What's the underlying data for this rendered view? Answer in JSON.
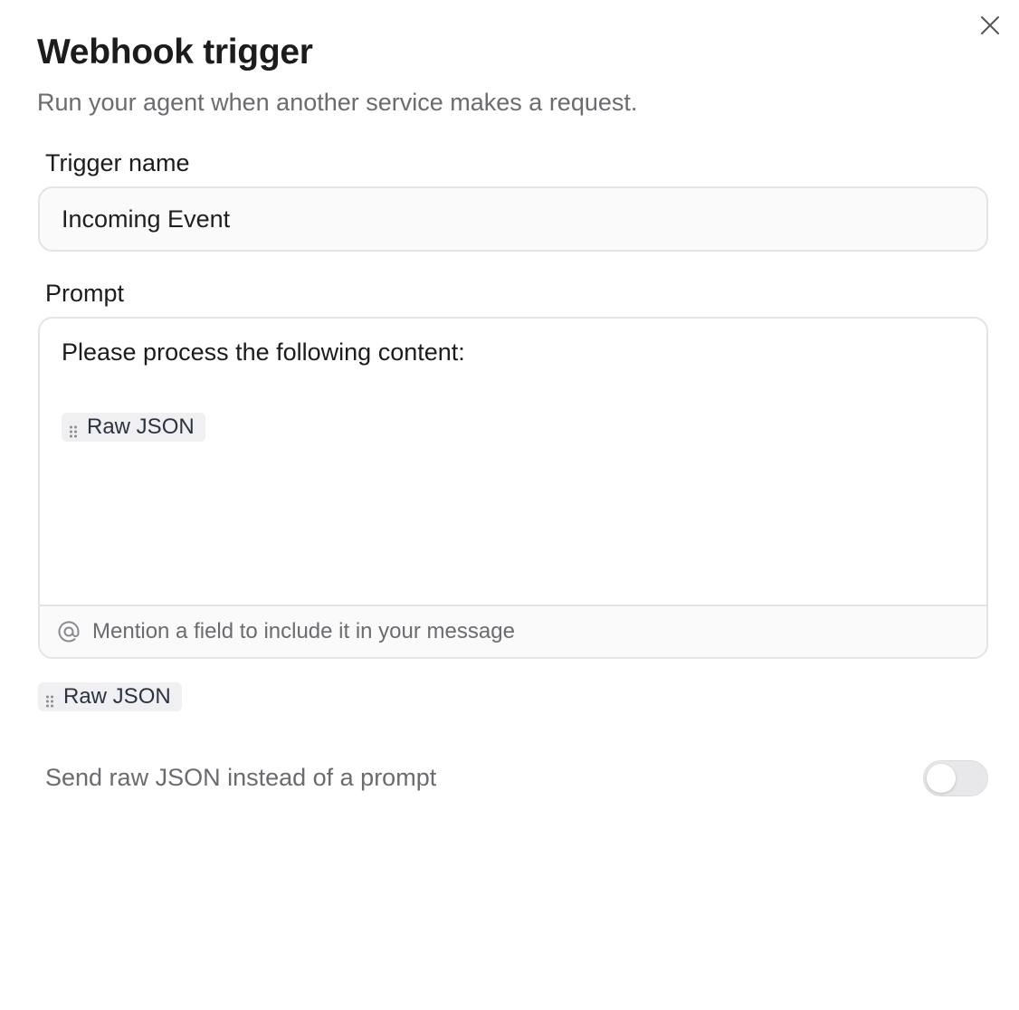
{
  "dialog": {
    "title": "Webhook trigger",
    "subtitle": "Run your agent when another service makes a request.",
    "close_icon": "close-icon"
  },
  "trigger_name": {
    "label": "Trigger name",
    "value": "Incoming Event"
  },
  "prompt": {
    "label": "Prompt",
    "text": "Please process the following content:",
    "inline_chip": {
      "label": "Raw JSON",
      "icon": "drag-handle-icon"
    },
    "footer": {
      "icon": "at-sign-icon",
      "hint": "Mention a field to include it in your message"
    }
  },
  "available_fields": [
    {
      "label": "Raw JSON",
      "icon": "drag-handle-icon"
    }
  ],
  "raw_json_toggle": {
    "label": "Send raw JSON instead of a prompt",
    "enabled": false
  },
  "colors": {
    "border": "#e4e4e7",
    "muted_text": "#6b6b70",
    "chip_bg": "#f0f0f2",
    "toggle_off_bg": "#e8e8ea"
  }
}
